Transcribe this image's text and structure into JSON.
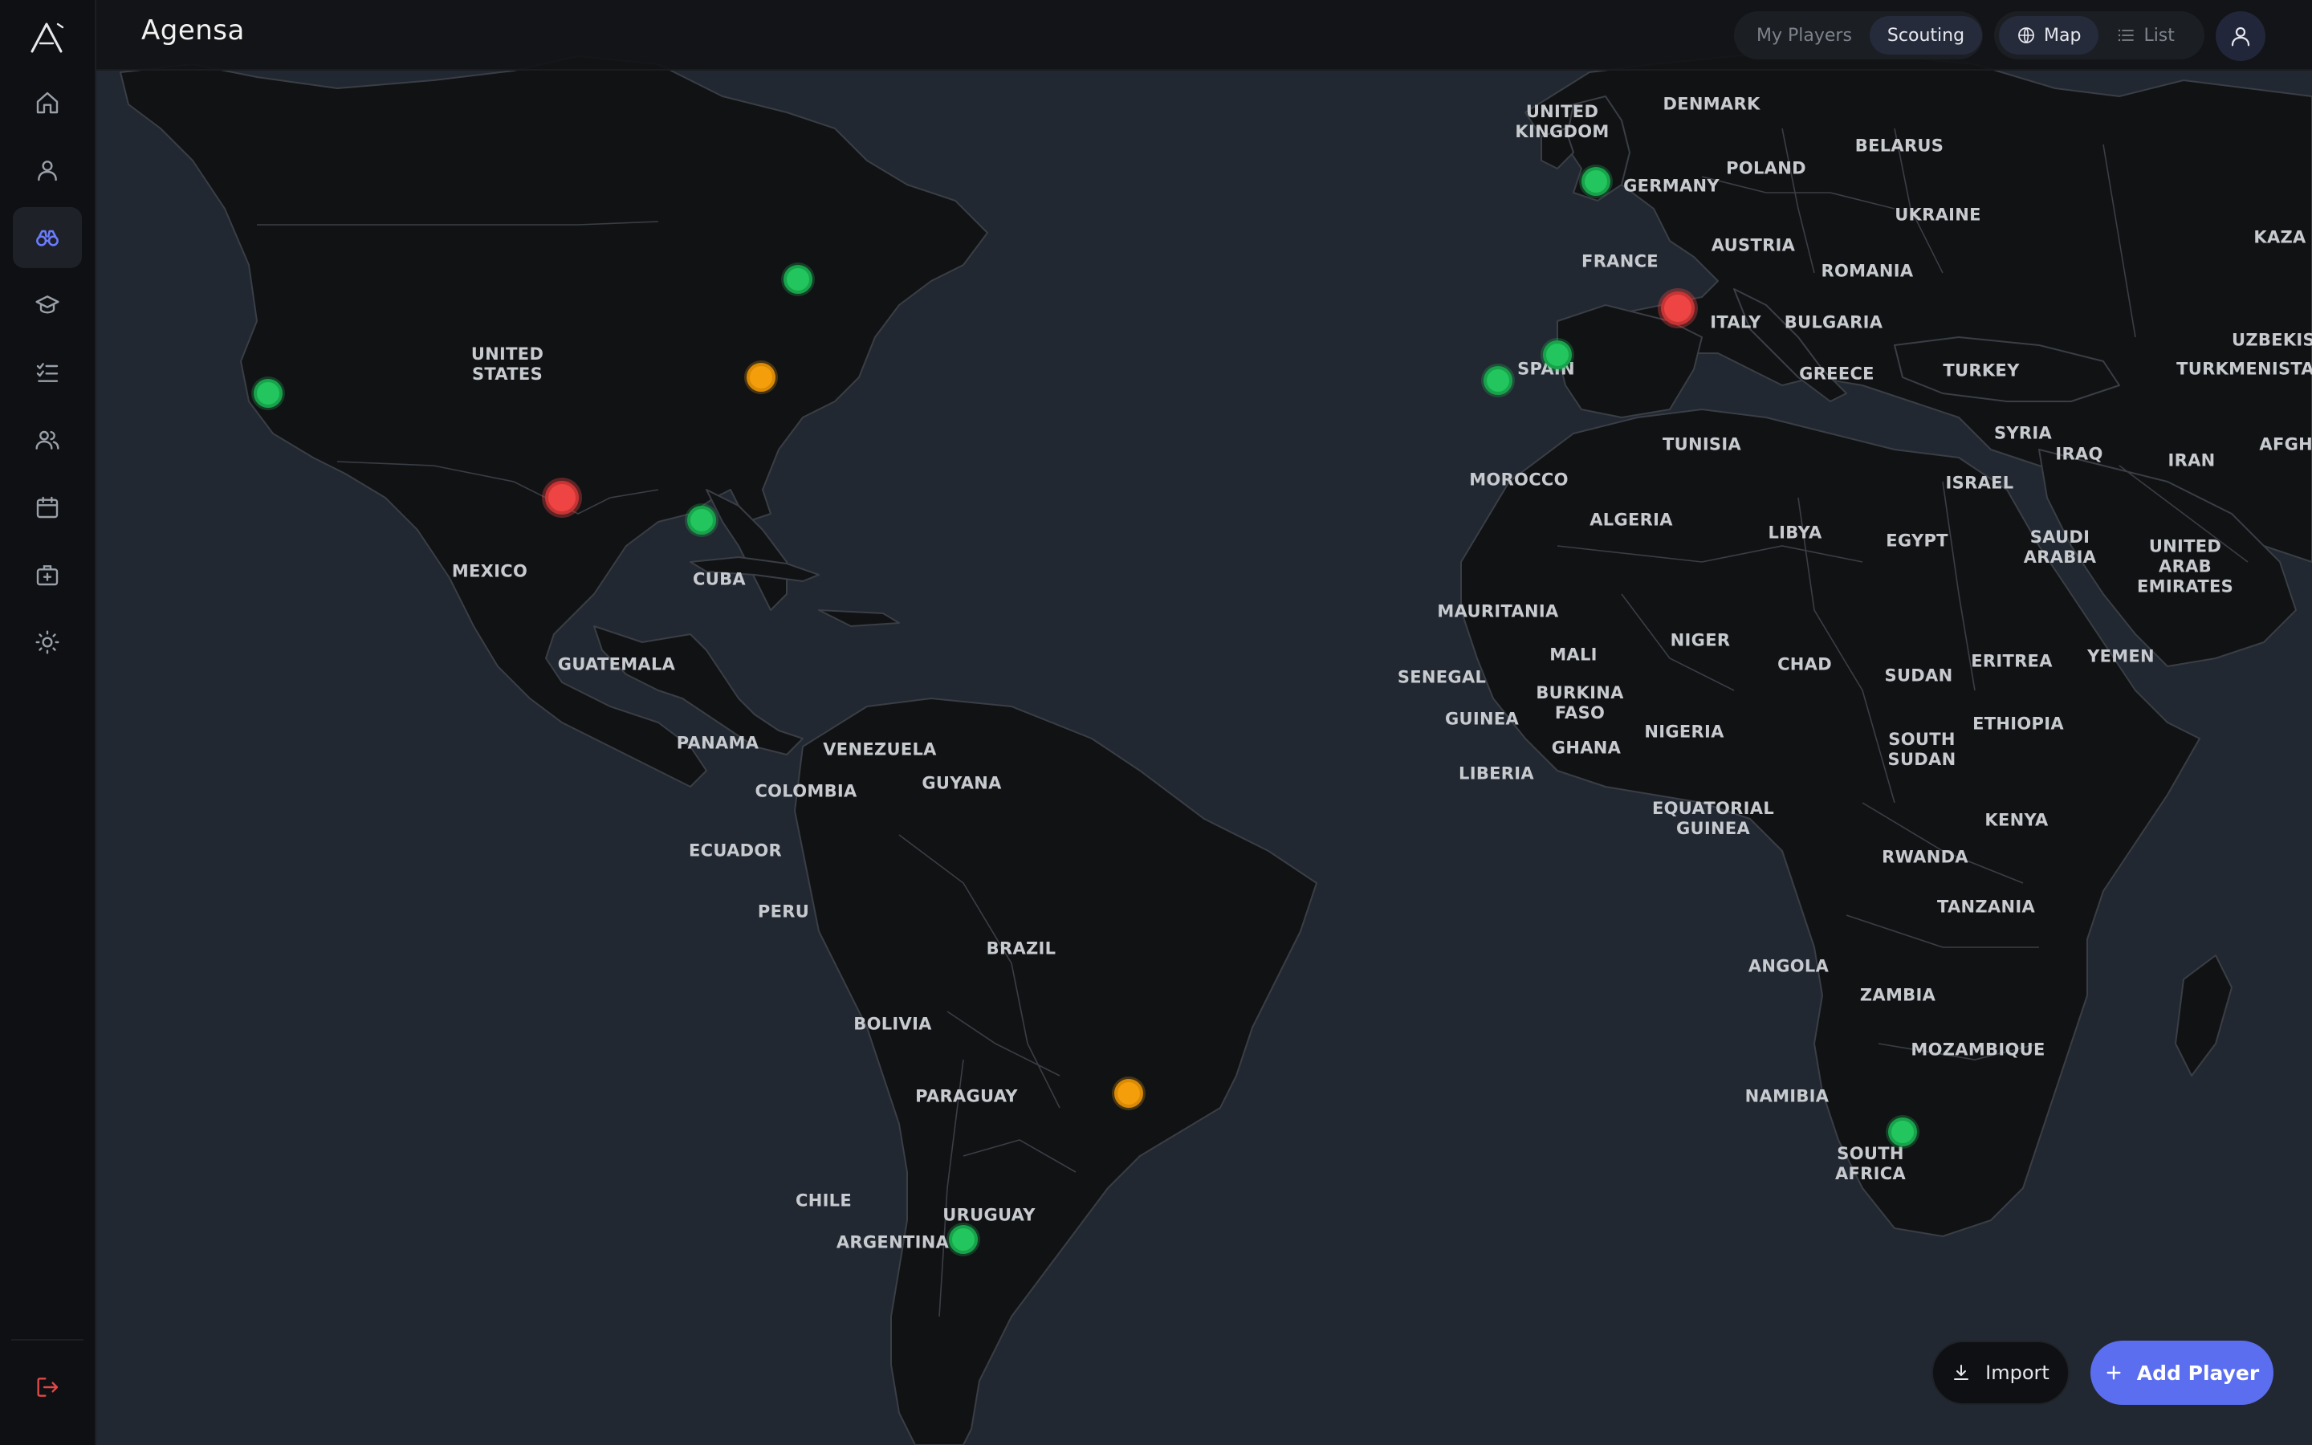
{
  "app": {
    "title": "Agensa"
  },
  "sidebar": {
    "items": [
      {
        "name": "home",
        "icon": "home-icon",
        "active": false
      },
      {
        "name": "profile",
        "icon": "user-icon",
        "active": false
      },
      {
        "name": "scouting",
        "icon": "binoculars-icon",
        "active": true
      },
      {
        "name": "academy",
        "icon": "graduation-cap-icon",
        "active": false
      },
      {
        "name": "tasks",
        "icon": "checklist-icon",
        "active": false
      },
      {
        "name": "team",
        "icon": "users-icon",
        "active": false
      },
      {
        "name": "calendar",
        "icon": "calendar-icon",
        "active": false
      },
      {
        "name": "medical",
        "icon": "medical-kit-icon",
        "active": false
      },
      {
        "name": "settings",
        "icon": "sun-icon",
        "active": false
      }
    ],
    "logout_icon": "logout-icon"
  },
  "header": {
    "scope_tabs": [
      {
        "label": "My Players",
        "active": false
      },
      {
        "label": "Scouting",
        "active": true
      }
    ],
    "view_tabs": [
      {
        "label": "Map",
        "icon": "globe-icon",
        "active": true
      },
      {
        "label": "List",
        "icon": "list-icon",
        "active": false
      }
    ],
    "profile_icon": "user-icon"
  },
  "map": {
    "countries": {
      "united_kingdom": "UNITED\nKINGDOM",
      "denmark": "DENMARK",
      "belarus": "BELARUS",
      "poland": "POLAND",
      "germany": "GERMANY",
      "ukraine": "UKRAINE",
      "kaza": "KAZA",
      "austria": "AUSTRIA",
      "france": "FRANCE",
      "romania": "ROMANIA",
      "uzbekis": "UZBEKIS",
      "italy": "ITALY",
      "bulgaria": "BULGARIA",
      "turkmenistan": "TURKMENISTAN",
      "spain": "SPAIN",
      "greece": "GREECE",
      "turkey": "TURKEY",
      "syria": "SYRIA",
      "afgha": "AFGHA",
      "tunisia": "TUNISIA",
      "iraq": "IRAQ",
      "iran": "IRAN",
      "israel": "ISRAEL",
      "morocco": "MOROCCO",
      "algeria": "ALGERIA",
      "libya": "LIBYA",
      "egypt": "EGYPT",
      "saudi_arabia": "SAUDI\nARABIA",
      "uae": "UNITED\nARAB\nEMIRATES",
      "mauritania": "MAURITANIA",
      "mali": "MALI",
      "niger": "NIGER",
      "chad": "CHAD",
      "sudan": "SUDAN",
      "eritrea": "ERITREA",
      "yemen": "YEMEN",
      "senegal": "SENEGAL",
      "guinea": "GUINEA",
      "burkina_faso": "BURKINA\nFASO",
      "ghana": "GHANA",
      "nigeria": "NIGERIA",
      "ethiopia": "ETHIOPIA",
      "south_sudan": "SOUTH\nSUDAN",
      "liberia": "LIBERIA",
      "equatorial_guinea": "EQUATORIAL\nGUINEA",
      "kenya": "KENYA",
      "rwanda": "RWANDA",
      "tanzania": "TANZANIA",
      "angola": "ANGOLA",
      "zambia": "ZAMBIA",
      "mozambique": "MOZAMBIQUE",
      "namibia": "NAMIBIA",
      "south_africa": "SOUTH\nAFRICA",
      "united_states": "UNITED\nSTATES",
      "mexico": "MEXICO",
      "cuba": "CUBA",
      "guatemala": "GUATEMALA",
      "panama": "PANAMA",
      "venezuela": "VENEZUELA",
      "guyana": "GUYANA",
      "colombia": "COLOMBIA",
      "ecuador": "ECUADOR",
      "peru": "PERU",
      "brazil": "BRAZIL",
      "bolivia": "BOLIVIA",
      "paraguay": "PARAGUAY",
      "chile": "CHILE",
      "uruguay": "URUGUAY",
      "argentina": "ARGENTINA"
    },
    "marker_colors": {
      "green": "#22c55e",
      "orange": "#f59e0b",
      "red": "#ef4444"
    }
  },
  "actions": {
    "import_label": "Import",
    "import_icon": "download-icon",
    "add_label": "Add Player",
    "add_icon": "plus-icon"
  }
}
